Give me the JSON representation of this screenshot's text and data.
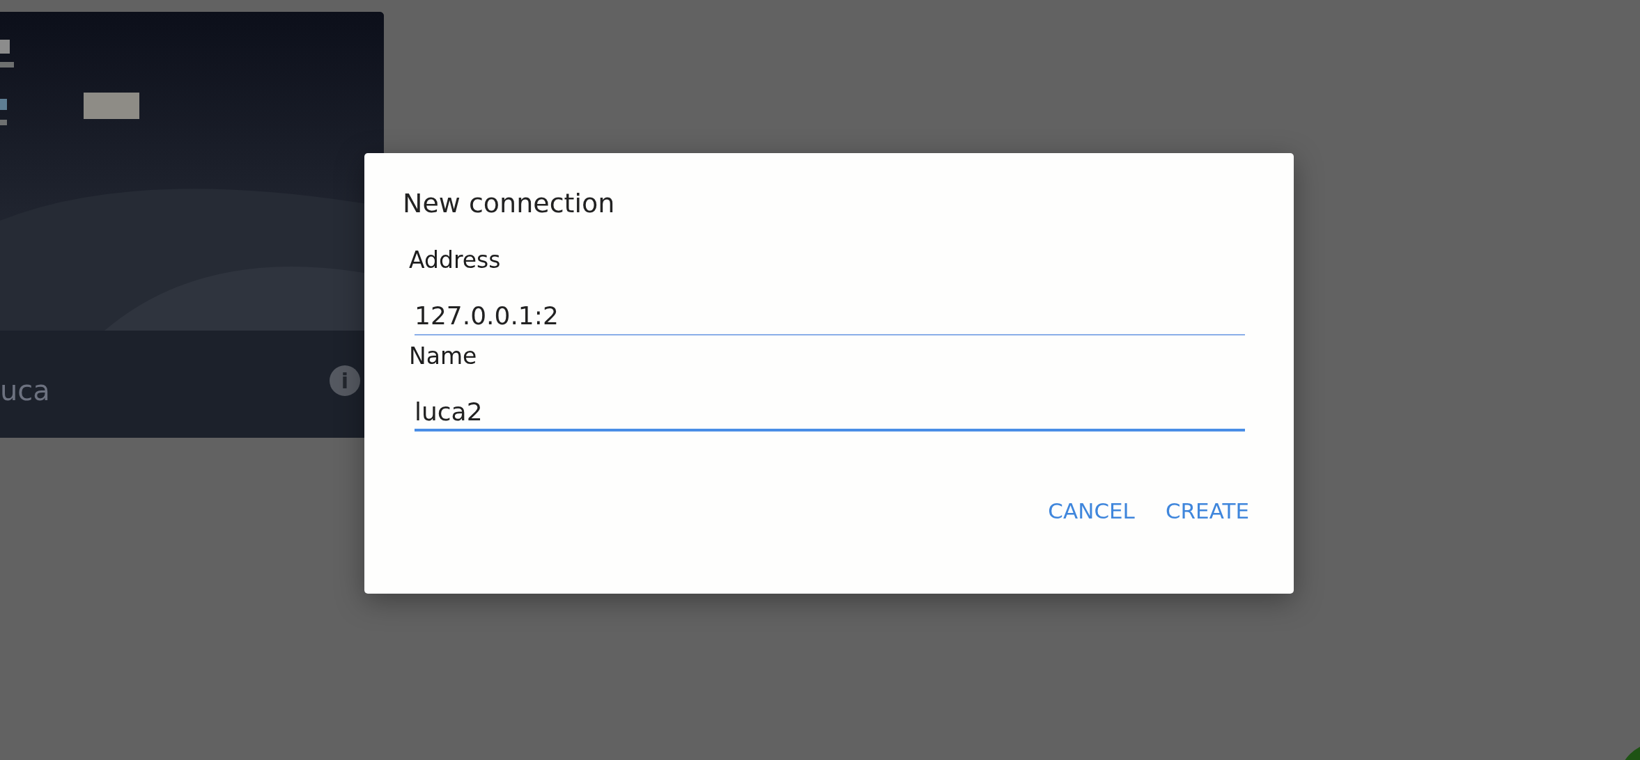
{
  "card": {
    "kind": "picture",
    "title": "uca",
    "info": "i"
  },
  "dialog": {
    "title": "New connection",
    "fields": [
      {
        "label": "Address",
        "value": "127.0.0.1:2",
        "focused": false
      },
      {
        "label": "Name",
        "value": "luca2",
        "focused": true
      }
    ],
    "buttons": [
      "CANCEL",
      "CREATE"
    ]
  }
}
